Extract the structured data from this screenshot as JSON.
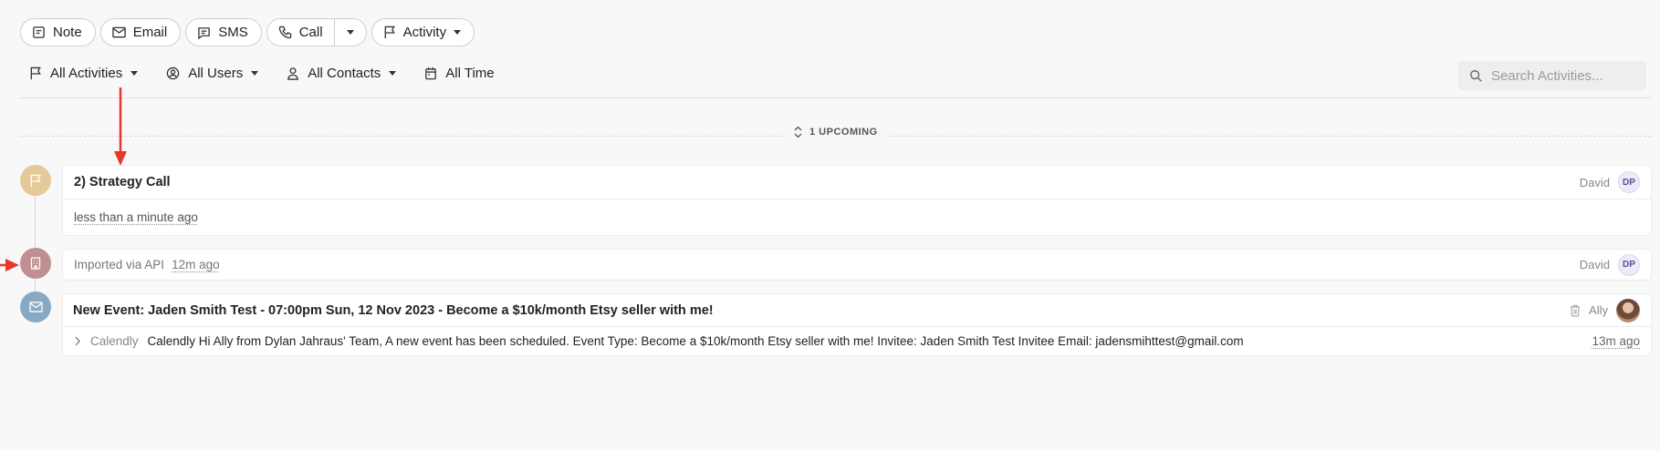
{
  "toolbar": {
    "note": "Note",
    "email": "Email",
    "sms": "SMS",
    "call": "Call",
    "activity": "Activity"
  },
  "filters": {
    "activities": "All Activities",
    "users": "All Users",
    "contacts": "All Contacts",
    "time": "All Time"
  },
  "search": {
    "placeholder": "Search Activities..."
  },
  "upcoming": {
    "label": "1 UPCOMING"
  },
  "items": [
    {
      "title": "2) Strategy Call",
      "user": "David",
      "initials": "DP",
      "time": "less than a minute ago",
      "dot_color": "#e6c99a"
    },
    {
      "text": "Imported via API",
      "time": "12m ago",
      "user": "David",
      "initials": "DP",
      "dot_color": "#bf8f92"
    },
    {
      "title": "New Event: Jaden Smith Test - 07:00pm Sun, 12 Nov 2023 - Become a $10k/month Etsy seller with me!",
      "user": "Ally",
      "source": "Calendly",
      "body": "Calendly Hi Ally from Dylan Jahraus' Team, A new event has been scheduled. Event Type: Become a $10k/month Etsy seller with me! Invitee: Jaden Smith Test Invitee Email: jadensmihttest@gmail.com",
      "time": "13m ago",
      "dot_color": "#88a9c3"
    }
  ],
  "annotation_color": "#e8372b"
}
